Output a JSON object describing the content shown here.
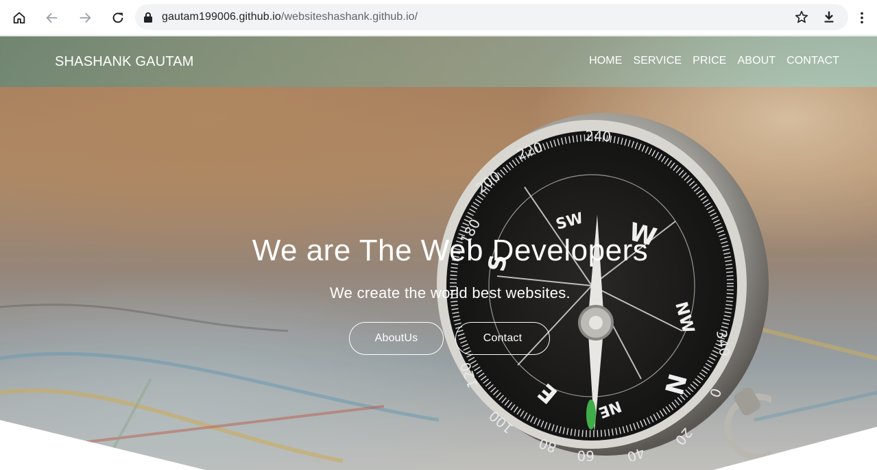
{
  "browser": {
    "url_host": "gautam199006.github.io",
    "url_path": "/websiteshashank.github.io/",
    "icons": [
      "home-icon",
      "back-icon",
      "forward-icon",
      "reload-icon",
      "lock-icon",
      "star-icon",
      "download-icon",
      "more-icon"
    ]
  },
  "site": {
    "brand": "SHASHANK GAUTAM",
    "nav": [
      "HOME",
      "SERVICE",
      "PRICE",
      "ABOUT",
      "CONTACT"
    ],
    "headline": "We are The Web Developers",
    "subline": "We create the world best websites.",
    "buttons": {
      "about": "AboutUs",
      "contact": "Contact"
    }
  },
  "compass": {
    "directions": [
      "SW",
      "W",
      "NW",
      "N",
      "NE",
      "S",
      "E"
    ],
    "degrees": [
      "240",
      "220",
      "200",
      "180",
      "340",
      "0",
      "20",
      "40",
      "60",
      "80",
      "100",
      "120"
    ]
  },
  "colors": {
    "text_white": "#ffffff",
    "chrome_bg": "#ffffff",
    "omnibox_bg": "#f1f3f4"
  }
}
